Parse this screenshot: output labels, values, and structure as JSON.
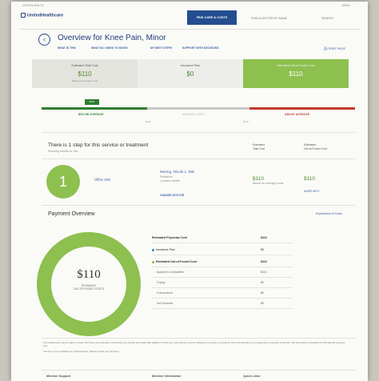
{
  "header": {
    "top_left": "UNITEDHEALTH",
    "top_right": "MENU",
    "logo": "UnitedHealthcare",
    "find_button": "FIND CARE & COSTS",
    "nav": [
      "FIND A DOCTOR BY NAME",
      "SEARCH"
    ]
  },
  "title": {
    "prefix": "Overview for ",
    "condition": "Knee Pain, Minor",
    "subnav": [
      "WHAT IS THIS",
      "WHAT DO I NEED TO KNOW",
      "MY NEXT STEPS",
      "SUPPORT WITH DECISIONS"
    ],
    "print": "PRINT PAGE"
  },
  "summary": {
    "boxes": [
      {
        "label": "Estimated Total Cost",
        "value": "$110",
        "sub": "Based on average costs"
      },
      {
        "label": "Insurance Plan",
        "value": "$0",
        "sub": ""
      },
      {
        "label": "Estimated Out-of-Pocket Cost",
        "value": "$110",
        "sub": ""
      }
    ]
  },
  "scale": {
    "tag": "$110",
    "labels": [
      "BELOW AVERAGE",
      "AVERAGE COST",
      "ABOVE AVERAGE"
    ],
    "ticks": [
      "$110",
      "$170"
    ]
  },
  "steps": {
    "title": "There is 1 step for this service or treatment",
    "subtitle": "Showing results for this",
    "col1": [
      "Estimated",
      "Total Cost"
    ],
    "col2": [
      "Estimated",
      "Out-of-Pocket Cost"
    ],
    "number": "1",
    "step_name": "Office Visit",
    "provider": "Moring, Nicole L. MD",
    "specialty": "Pediatrics",
    "location": "Location details",
    "change": "CHANGE DOCTOR",
    "total": "$110",
    "total_sub": "Based on average costs",
    "oop": "$110",
    "oop_sub": "MORE INFO"
  },
  "payment": {
    "title": "Payment Overview",
    "link": "Explanation of Costs",
    "donut_value": "$110",
    "donut_caption": [
      "ESTIMATED",
      "OUT-OF-POCKET COSTS"
    ],
    "rows": [
      {
        "label": "Estimated Physician Cost",
        "value": "$110",
        "bold": true,
        "dot": ""
      },
      {
        "label": "Insurance Plan",
        "value": "$0",
        "bold": false,
        "dot": "#3b82c4"
      },
      {
        "label": "Estimated Out-of-Pocket Cost",
        "value": "$110",
        "bold": true,
        "dot": "#8dc04f"
      },
      {
        "label": "Applied to Deductible",
        "value": "$110",
        "bold": false,
        "dot": ""
      },
      {
        "label": "Copay",
        "value": "$0",
        "bold": false,
        "dot": ""
      },
      {
        "label": "Coinsurance",
        "value": "$0",
        "bold": false,
        "dot": ""
      },
      {
        "label": "Not Covered",
        "value": "$0",
        "bold": false,
        "dot": ""
      }
    ]
  },
  "disclaimer": "Your actual costs may be higher or lower than these cost estimates. Check with your provider and health plan details to confirm the costs that you may be charged for a service or procedure. This cost estimate is not a guarantee of payment or benefits. The information is intended for informational purposes only.",
  "disclaimer2": "This site is not a substitute for medical advice. Please consult your physician.",
  "footer": [
    "Member Support",
    "Member Information",
    "Quick Links"
  ],
  "colors": {
    "brand": "#244d8f",
    "green": "#8dc04f",
    "below": "#2f7d2f",
    "above": "#c0392b",
    "gray": "#c8c8c8"
  }
}
